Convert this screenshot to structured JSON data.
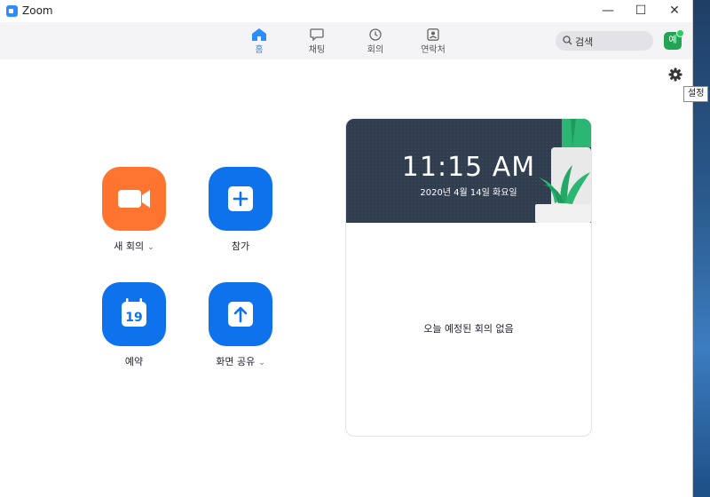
{
  "window": {
    "title": "Zoom"
  },
  "titlebar_controls": {
    "minimize": "—",
    "maximize": "☐",
    "close": "✕"
  },
  "nav": {
    "tabs": [
      {
        "label": "홈",
        "icon": "home-icon",
        "active": true
      },
      {
        "label": "채팅",
        "icon": "chat-icon",
        "active": false
      },
      {
        "label": "회의",
        "icon": "clock-icon",
        "active": false
      },
      {
        "label": "연락처",
        "icon": "contacts-icon",
        "active": false
      }
    ],
    "search_placeholder": "검색",
    "avatar_initial": "예",
    "presence_color": "#22d157"
  },
  "settings": {
    "tooltip": "설정"
  },
  "actions": [
    {
      "label": "새 회의",
      "icon": "video-camera-icon",
      "color": "#ff742e",
      "has_dropdown": true
    },
    {
      "label": "참가",
      "icon": "plus-icon",
      "color": "#0e72ed",
      "has_dropdown": false
    },
    {
      "label": "예약",
      "icon": "calendar-icon",
      "calendar_day": "19",
      "color": "#0e72ed",
      "has_dropdown": false
    },
    {
      "label": "화면 공유",
      "icon": "share-screen-icon",
      "color": "#0e72ed",
      "has_dropdown": true
    }
  ],
  "calendar": {
    "time": "11:15 AM",
    "date": "2020년 4월 14일 화요일",
    "empty_message": "오늘 예정된 회의 없음"
  },
  "colors": {
    "accent": "#2d8cff",
    "header_bg": "#2f3d4f"
  }
}
